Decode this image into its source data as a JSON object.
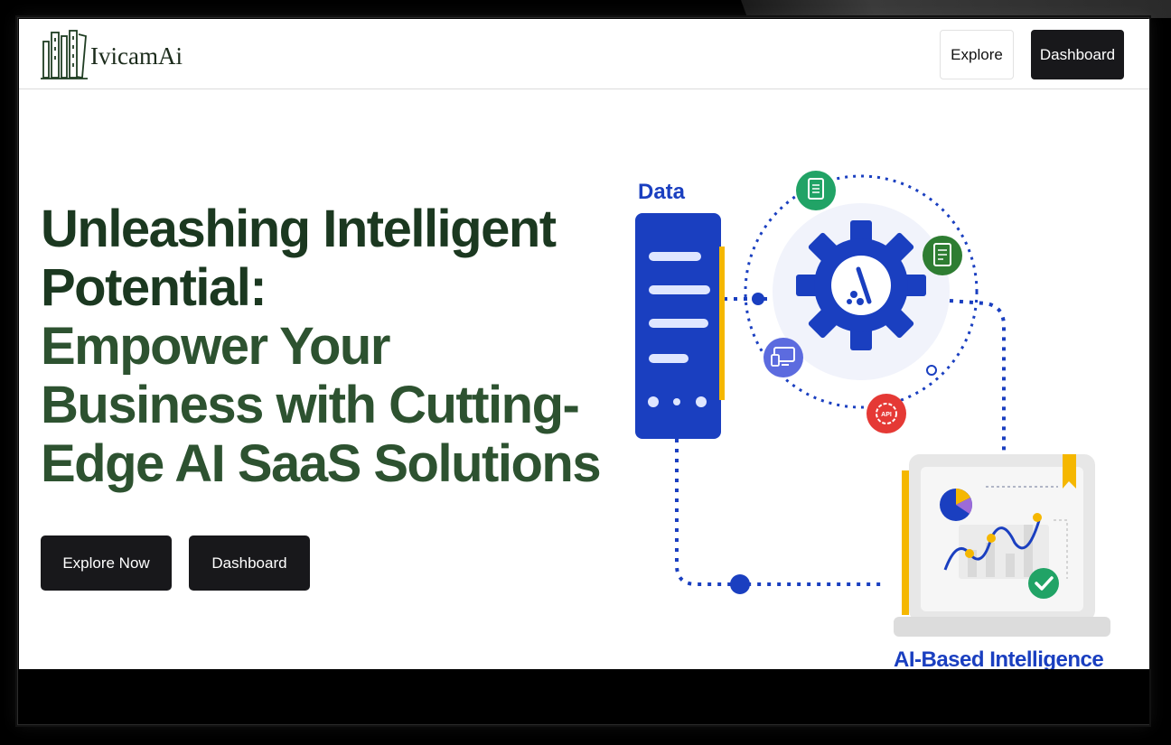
{
  "brand": {
    "name": "IvicamAi",
    "logo_icon": "bookshelf-logo"
  },
  "nav": {
    "explore_label": "Explore",
    "dashboard_label": "Dashboard"
  },
  "hero": {
    "title_line1": "Unleashing Intelligent Potential:",
    "title_line2": "Empower Your Business with Cutting-Edge AI SaaS Solutions",
    "primary_cta": "Explore Now",
    "secondary_cta": "Dashboard"
  },
  "illustration": {
    "data_label": "Data",
    "ai_label": "AI-Based Intelligence",
    "badge_text": "API",
    "icons": [
      "server-icon",
      "gear-icon",
      "document-icon",
      "spreadsheet-icon",
      "devices-icon",
      "api-icon",
      "laptop-icon",
      "pie-chart-icon",
      "check-icon",
      "bookmark-icon"
    ]
  },
  "colors": {
    "heading_dark": "#1b3820",
    "heading_green": "#2d5230",
    "button_dark": "#18181b",
    "illustration_blue": "#1a3fc0",
    "accent_yellow": "#f5b700",
    "icon_green": "#21a366",
    "icon_red": "#e53935",
    "icon_purple": "#5c6bdf"
  }
}
